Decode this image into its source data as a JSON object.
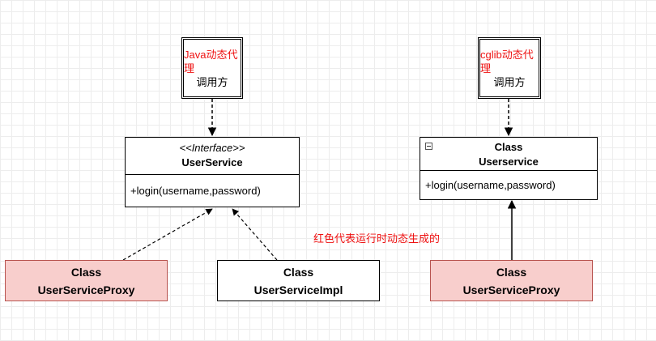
{
  "left": {
    "caller": {
      "title": "Java动态代理",
      "label": "调用方"
    },
    "interface": {
      "stereotype": "<<Interface>>",
      "name": "UserService",
      "method": "+login(username,password)"
    },
    "proxy": {
      "kind": "Class",
      "name": "UserServiceProxy"
    },
    "impl": {
      "kind": "Class",
      "name": "UserServiceImpl"
    }
  },
  "right": {
    "caller": {
      "title": "cglib动态代理",
      "label": "调用方"
    },
    "class": {
      "kind": "Class",
      "name": "Userservice",
      "method": "+login(username,password)"
    },
    "proxy": {
      "kind": "Class",
      "name": "UserServiceProxy"
    }
  },
  "note": "红色代表运行时动态生成的",
  "colors": {
    "runtime_fill": "#f8cecc",
    "runtime_border": "#b85450",
    "note_text": "#ee1111"
  }
}
